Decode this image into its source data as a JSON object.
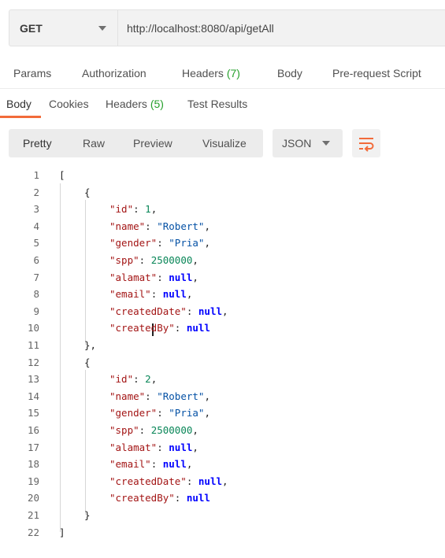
{
  "request": {
    "method": "GET",
    "url": "http://localhost:8080/api/getAll"
  },
  "request_tabs": [
    {
      "label": "Params"
    },
    {
      "label": "Authorization"
    },
    {
      "label": "Headers",
      "count": "(7)"
    },
    {
      "label": "Body"
    },
    {
      "label": "Pre-request Script"
    }
  ],
  "response_tabs": [
    {
      "label": "Body",
      "active": true
    },
    {
      "label": "Cookies"
    },
    {
      "label": "Headers",
      "count": "(5)"
    },
    {
      "label": "Test Results"
    }
  ],
  "view_modes": [
    "Pretty",
    "Raw",
    "Preview",
    "Visualize"
  ],
  "format": "JSON",
  "colors": {
    "accent": "#f26b3a",
    "count": "#26a02c",
    "json_key": "#a31515",
    "json_string": "#0451a5",
    "json_number": "#098658",
    "json_null": "#0000ff"
  },
  "response_lines": [
    {
      "num": 1,
      "depth": 0,
      "tokens": [
        [
          "p",
          "["
        ]
      ]
    },
    {
      "num": 2,
      "depth": 1,
      "tokens": [
        [
          "p",
          "{"
        ]
      ]
    },
    {
      "num": 3,
      "depth": 2,
      "tokens": [
        [
          "k",
          "\"id\""
        ],
        [
          "p",
          ": "
        ],
        [
          "n",
          "1"
        ],
        [
          "p",
          ","
        ]
      ]
    },
    {
      "num": 4,
      "depth": 2,
      "tokens": [
        [
          "k",
          "\"name\""
        ],
        [
          "p",
          ": "
        ],
        [
          "s",
          "\"Robert\""
        ],
        [
          "p",
          ","
        ]
      ]
    },
    {
      "num": 5,
      "depth": 2,
      "tokens": [
        [
          "k",
          "\"gender\""
        ],
        [
          "p",
          ": "
        ],
        [
          "s",
          "\"Pria\""
        ],
        [
          "p",
          ","
        ]
      ]
    },
    {
      "num": 6,
      "depth": 2,
      "tokens": [
        [
          "k",
          "\"spp\""
        ],
        [
          "p",
          ": "
        ],
        [
          "n",
          "2500000"
        ],
        [
          "p",
          ","
        ]
      ]
    },
    {
      "num": 7,
      "depth": 2,
      "tokens": [
        [
          "k",
          "\"alamat\""
        ],
        [
          "p",
          ": "
        ],
        [
          "b",
          "null"
        ],
        [
          "p",
          ","
        ]
      ]
    },
    {
      "num": 8,
      "depth": 2,
      "tokens": [
        [
          "k",
          "\"email\""
        ],
        [
          "p",
          ": "
        ],
        [
          "b",
          "null"
        ],
        [
          "p",
          ","
        ]
      ]
    },
    {
      "num": 9,
      "depth": 2,
      "tokens": [
        [
          "k",
          "\"createdDate\""
        ],
        [
          "p",
          ": "
        ],
        [
          "b",
          "null"
        ],
        [
          "p",
          ","
        ]
      ]
    },
    {
      "num": 10,
      "depth": 2,
      "tokens": [
        [
          "k",
          "\"createdBy\""
        ],
        [
          "p",
          ": "
        ],
        [
          "b",
          "null"
        ]
      ]
    },
    {
      "num": 11,
      "depth": 1,
      "tokens": [
        [
          "p",
          "},"
        ]
      ]
    },
    {
      "num": 12,
      "depth": 1,
      "tokens": [
        [
          "p",
          "{"
        ]
      ]
    },
    {
      "num": 13,
      "depth": 2,
      "tokens": [
        [
          "k",
          "\"id\""
        ],
        [
          "p",
          ": "
        ],
        [
          "n",
          "2"
        ],
        [
          "p",
          ","
        ]
      ]
    },
    {
      "num": 14,
      "depth": 2,
      "tokens": [
        [
          "k",
          "\"name\""
        ],
        [
          "p",
          ": "
        ],
        [
          "s",
          "\"Robert\""
        ],
        [
          "p",
          ","
        ]
      ]
    },
    {
      "num": 15,
      "depth": 2,
      "tokens": [
        [
          "k",
          "\"gender\""
        ],
        [
          "p",
          ": "
        ],
        [
          "s",
          "\"Pria\""
        ],
        [
          "p",
          ","
        ]
      ]
    },
    {
      "num": 16,
      "depth": 2,
      "tokens": [
        [
          "k",
          "\"spp\""
        ],
        [
          "p",
          ": "
        ],
        [
          "n",
          "2500000"
        ],
        [
          "p",
          ","
        ]
      ]
    },
    {
      "num": 17,
      "depth": 2,
      "tokens": [
        [
          "k",
          "\"alamat\""
        ],
        [
          "p",
          ": "
        ],
        [
          "b",
          "null"
        ],
        [
          "p",
          ","
        ]
      ]
    },
    {
      "num": 18,
      "depth": 2,
      "tokens": [
        [
          "k",
          "\"email\""
        ],
        [
          "p",
          ": "
        ],
        [
          "b",
          "null"
        ],
        [
          "p",
          ","
        ]
      ]
    },
    {
      "num": 19,
      "depth": 2,
      "tokens": [
        [
          "k",
          "\"createdDate\""
        ],
        [
          "p",
          ": "
        ],
        [
          "b",
          "null"
        ],
        [
          "p",
          ","
        ]
      ]
    },
    {
      "num": 20,
      "depth": 2,
      "tokens": [
        [
          "k",
          "\"createdBy\""
        ],
        [
          "p",
          ": "
        ],
        [
          "b",
          "null"
        ]
      ]
    },
    {
      "num": 21,
      "depth": 1,
      "tokens": [
        [
          "p",
          "}"
        ]
      ]
    },
    {
      "num": 22,
      "depth": 0,
      "tokens": [
        [
          "p",
          "]"
        ]
      ]
    }
  ]
}
